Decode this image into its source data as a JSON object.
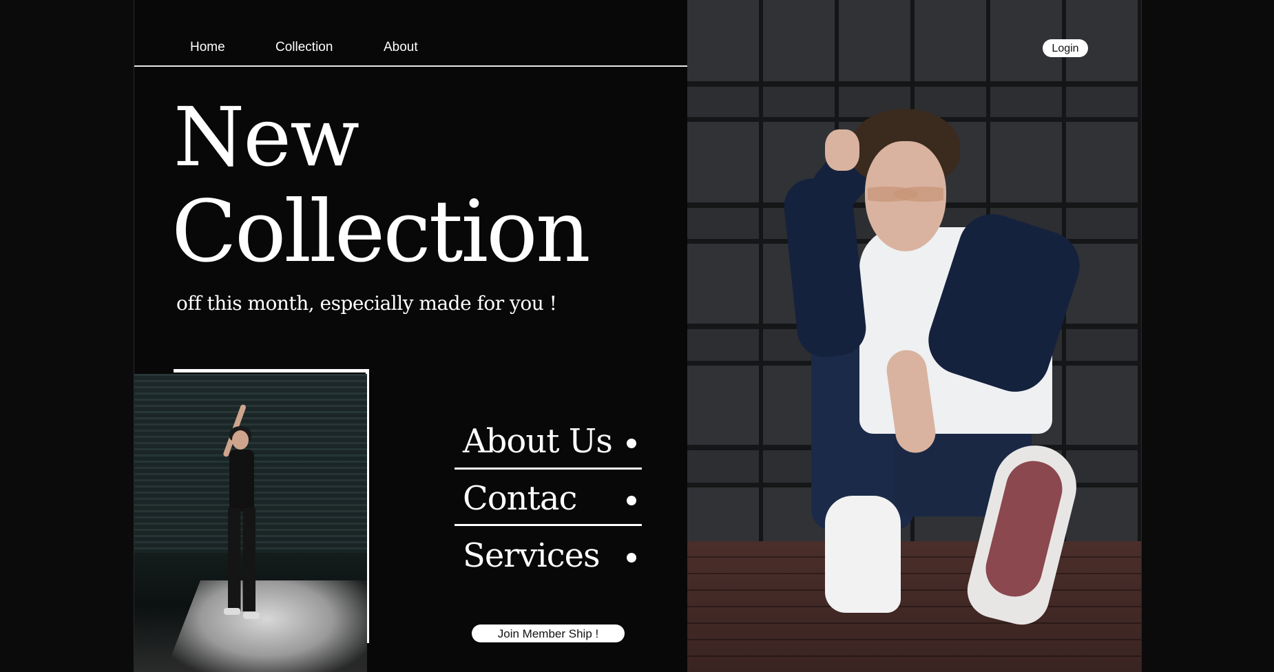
{
  "nav": {
    "home": "Home",
    "collection": "Collection",
    "about": "About",
    "login": "Login"
  },
  "hero": {
    "title_line1": "New",
    "title_line2": "Collection",
    "subtitle": "off this month, especially made for you !"
  },
  "menu": {
    "items": [
      "About Us",
      "Contac",
      "Services"
    ]
  },
  "cta": {
    "join": "Join Member Ship !"
  },
  "colors": {
    "background": "#080808",
    "accent": "#ffffff"
  }
}
